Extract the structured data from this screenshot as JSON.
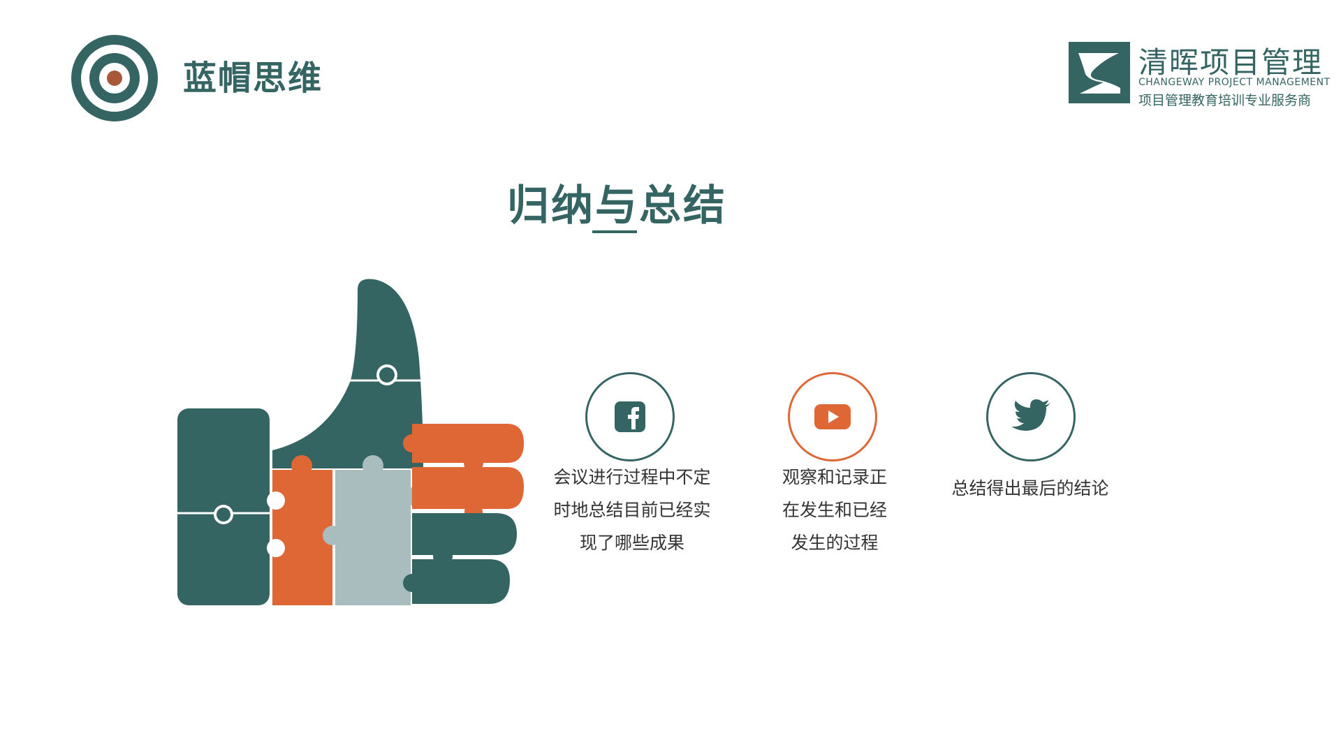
{
  "header": {
    "title": "蓝帽思维",
    "logo_icon": "target-icon"
  },
  "brand": {
    "name": "清晖项目管理",
    "english": "CHANGEWAY PROJECT MANAGEMENT",
    "tagline": "项目管理教育培训专业服务商",
    "mark_icon": "changeway-logo-icon"
  },
  "section": {
    "title": "归纳与总结"
  },
  "illustration": {
    "icon": "puzzle-thumbs-up-icon"
  },
  "items": [
    {
      "icon": "facebook-icon",
      "lines": [
        "会议进行过程中不定",
        "时地总结目前已经实",
        "现了哪些成果"
      ]
    },
    {
      "icon": "youtube-icon",
      "lines": [
        "观察和记录正",
        "在发生和已经",
        "发生的过程"
      ]
    },
    {
      "icon": "twitter-icon",
      "lines": [
        "总结得出最后的结论"
      ]
    }
  ],
  "colors": {
    "teal": "#356563",
    "orange": "#df6736",
    "gray": "#a9bdbe",
    "text": "#333333"
  }
}
